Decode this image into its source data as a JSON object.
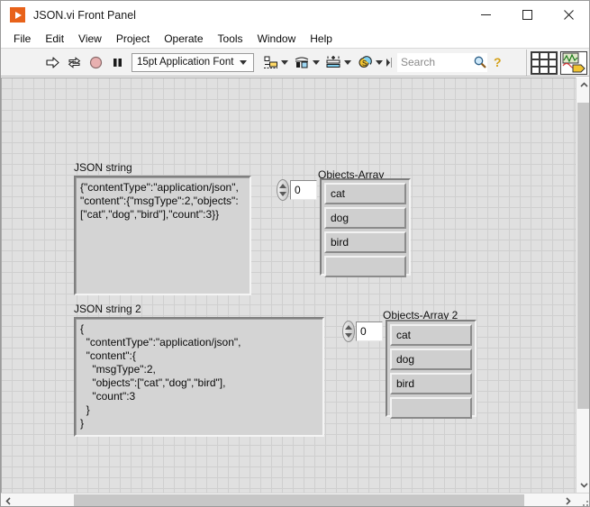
{
  "window": {
    "title": "JSON.vi Front Panel",
    "app_icon": "labview-vi-icon",
    "minimize_label": "Minimize",
    "maximize_label": "Maximize",
    "close_label": "Close"
  },
  "menubar": {
    "items": [
      {
        "label": "File"
      },
      {
        "label": "Edit"
      },
      {
        "label": "View"
      },
      {
        "label": "Project"
      },
      {
        "label": "Operate"
      },
      {
        "label": "Tools"
      },
      {
        "label": "Window"
      },
      {
        "label": "Help"
      }
    ]
  },
  "toolbar": {
    "run_label": "Run",
    "run_continuously_label": "Run Continuously",
    "abort_label": "Abort Execution",
    "pause_label": "Pause",
    "font_select_value": "15pt Application Font",
    "align_label": "Align Objects",
    "distribute_label": "Distribute Objects",
    "resize_label": "Resize Objects",
    "reorder_label": "Reorder",
    "search_placeholder": "Search",
    "help_label": "Show Context Help"
  },
  "panel": {
    "controls": [
      {
        "name": "json-string",
        "label": "JSON string",
        "type": "string",
        "value": "{\"contentType\":\"application/json\",\n\"content\":{\"msgType\":2,\"objects\":\n[\"cat\",\"dog\",\"bird\"],\"count\":3}}"
      },
      {
        "name": "objects-array",
        "label": "Objects-Array",
        "type": "array",
        "index": "0",
        "elements": [
          "cat",
          "dog",
          "bird",
          ""
        ]
      },
      {
        "name": "json-string-2",
        "label": "JSON string 2",
        "type": "string",
        "value": "{\n  \"contentType\":\"application/json\",\n  \"content\":{\n    \"msgType\":2,\n    \"objects\":[\"cat\",\"dog\",\"bird\"],\n    \"count\":3\n  }\n}"
      },
      {
        "name": "objects-array-2",
        "label": "Objects-Array 2",
        "type": "array",
        "index": "0",
        "elements": [
          "cat",
          "dog",
          "bird",
          ""
        ]
      }
    ]
  },
  "scrollbars": {
    "vertical_up": "▲",
    "vertical_down": "▼",
    "horizontal_left": "◀",
    "horizontal_right": "▶"
  },
  "colors": {
    "accent_orange": "#e8621a",
    "panel_bg": "#e0e0e0",
    "grid_line": "#cfcfcf",
    "control_face": "#d4d4d4",
    "toolbar_bg": "#f2f2f2"
  }
}
